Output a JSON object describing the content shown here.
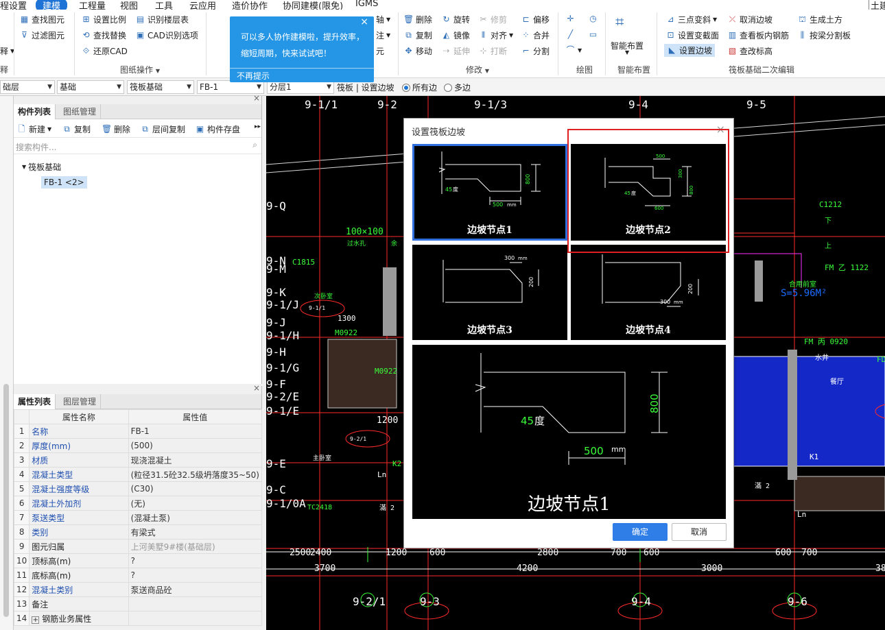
{
  "menu": {
    "items": [
      "程设置",
      "建模",
      "工程量",
      "视图",
      "工具",
      "云应用",
      "造价协作",
      "协同建模(限免)",
      "IGMS",
      "土建"
    ],
    "active": "建模"
  },
  "ribbon": {
    "left_cut": {
      "a": "释",
      "b": "释"
    },
    "drawing": {
      "find": "查找图元",
      "filter": "过滤图元"
    },
    "cad": {
      "set_scale": "设置比例",
      "find_replace": "查找替换",
      "restore_cad": "还原CAD",
      "identify_floor": "识别楼层表",
      "cad_options": "CAD识别选项",
      "group": "图纸操作"
    },
    "tooltip_hidden": {
      "a": "轴",
      "b": "注",
      "c": "元"
    },
    "modify": {
      "delete": "删除",
      "rotate": "旋转",
      "trim": "修剪",
      "offset": "偏移",
      "copy": "复制",
      "mirror": "镜像",
      "align": "对齐",
      "merge": "合并",
      "move": "移动",
      "extend": "延伸",
      "break": "打断",
      "split": "分割",
      "group": "修改"
    },
    "draw": {
      "group": "绘图"
    },
    "smart": {
      "label": "智能布置",
      "group": "智能布置"
    },
    "raft": {
      "three_point": "三点变斜",
      "cancel_slope": "取消边坡",
      "gen_earth": "生成土方",
      "set_section": "设置变截面",
      "view_rebar": "查看板内钢筋",
      "split_by_beam": "按梁分割板",
      "set_slope": "设置边坡",
      "check_elev": "查改标高",
      "group": "筏板基础二次编辑"
    }
  },
  "filterbar": {
    "floor": "础层",
    "type": "基础",
    "sub": "筏板基础",
    "item": "FB-1",
    "layer": "分层1",
    "crumb": "筏板 | 设置边坡",
    "opt_all": "所有边",
    "opt_multi": "多边"
  },
  "component_panel": {
    "tab1": "构件列表",
    "tab2": "图纸管理",
    "new": "新建",
    "copy": "复制",
    "delete": "删除",
    "floor_copy": "层间复制",
    "store": "构件存盘",
    "search_placeholder": "搜索构件...",
    "tree_root": "筏板基础",
    "tree_item": "FB-1 <2>"
  },
  "props_panel": {
    "tab1": "属性列表",
    "tab2": "图层管理",
    "col_name": "属性名称",
    "col_value": "属性值",
    "rows": [
      {
        "n": "1",
        "k": "名称",
        "v": "FB-1"
      },
      {
        "n": "2",
        "k": "厚度(mm)",
        "v": "(500)"
      },
      {
        "n": "3",
        "k": "材质",
        "v": "现浇混凝土"
      },
      {
        "n": "4",
        "k": "混凝土类型",
        "v": "(粒径31.5砼32.5级坍落度35~50)"
      },
      {
        "n": "5",
        "k": "混凝土强度等级",
        "v": "(C30)"
      },
      {
        "n": "6",
        "k": "混凝土外加剂",
        "v": "(无)"
      },
      {
        "n": "7",
        "k": "泵送类型",
        "v": "(混凝土泵)"
      },
      {
        "n": "8",
        "k": "类别",
        "v": "有梁式"
      },
      {
        "n": "9",
        "k": "图元归属",
        "v": "上河美墅9#楼(基础层)"
      },
      {
        "n": "10",
        "k": "顶标高(m)",
        "v": "?"
      },
      {
        "n": "11",
        "k": "底标高(m)",
        "v": "?"
      },
      {
        "n": "12",
        "k": "混凝土类别",
        "v": "泵送商品砼"
      },
      {
        "n": "13",
        "k": "备注",
        "v": ""
      },
      {
        "n": "14",
        "k": "钢筋业务属性",
        "v": ""
      }
    ]
  },
  "tooltip": {
    "line1": "可以多人协作建模啦，提升效率，",
    "line2": "缩短周期，快来试试吧！",
    "dismiss": "不再提示"
  },
  "dialog": {
    "title": "设置筏板边坡",
    "tiles": [
      "边坡节点1",
      "边坡节点2",
      "边坡节点3",
      "边坡节点4"
    ],
    "preview_label": "边坡节点1",
    "dims": {
      "n1_h": "800",
      "n1_w": "500",
      "n1_angle": "45",
      "n1_angle_unit": "度",
      "mm": "mm",
      "n2_top": "500",
      "n2_h1": "300",
      "n2_h2": "800",
      "n2_w": "600",
      "n3_w": "300",
      "n3_h": "200",
      "n4_w": "300",
      "n4_h": "200"
    },
    "ok": "确定",
    "cancel": "取消"
  },
  "cad": {
    "axes_top": [
      "9-1/1",
      "9-2",
      "9-1/3",
      "9-4",
      "9-5"
    ],
    "axes_left": [
      "9-Q",
      "9-N",
      "9-M",
      "9-K",
      "9-1/J",
      "9-J",
      "9-1/H",
      "9-H",
      "9-1/G",
      "9-F",
      "9-2/E",
      "9-1/E",
      "9-E",
      "9-C",
      "9-1/0A"
    ],
    "axes_bottom": [
      "9-2/1",
      "9-3",
      "9-4",
      "9-6"
    ],
    "dims_row1": [
      "2500",
      "2400",
      "1200",
      "600",
      "2800",
      "700",
      "600",
      "600",
      "700"
    ],
    "dims_row2": [
      "3700",
      "4200",
      "3000",
      "38"
    ],
    "labels": [
      "100×100",
      "过水孔",
      "余",
      "C1815",
      "次卧室",
      "M0922",
      "1300",
      "M0922",
      "1200",
      "主卧室",
      "TC2418",
      "Ln",
      "滿 2",
      "C1212",
      "下",
      "上",
      "FM 乙 1122",
      "合用前室",
      "S=5.96M²",
      "FM 丙 0920",
      "水井",
      "FD",
      "餐厅",
      "K1",
      "Ln",
      "滿 2",
      "K2",
      "9-1/1",
      "9-2/1"
    ]
  }
}
